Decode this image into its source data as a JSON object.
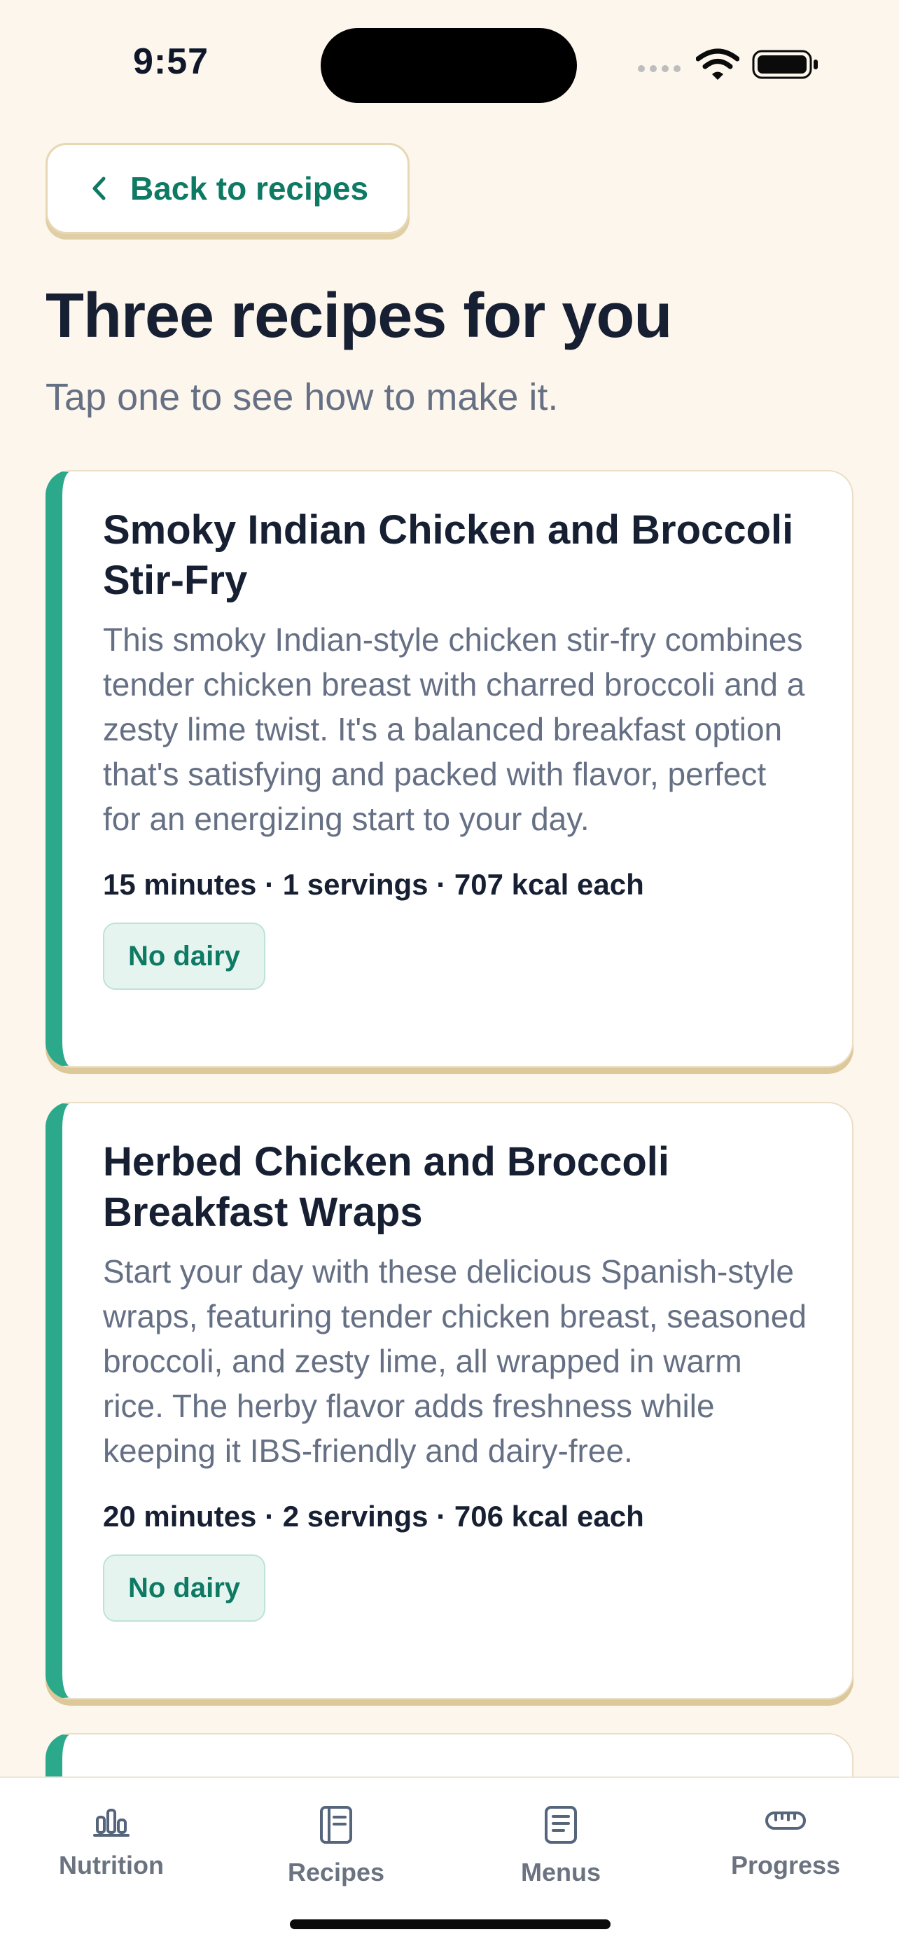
{
  "status_bar": {
    "time": "9:57"
  },
  "back_button": {
    "label": "Back to recipes",
    "icon": "chevron-left-icon"
  },
  "header": {
    "title": "Three recipes for you",
    "subtitle": "Tap one to see how to make it."
  },
  "recipes": [
    {
      "title": "Smoky Indian Chicken and Broccoli Stir-Fry",
      "description": "This smoky Indian-style chicken stir-fry combines tender chicken breast with charred broccoli and a zesty lime twist. It's a balanced breakfast option that's satisfying and packed with flavor, perfect for an energizing start to your day.",
      "meta": "15 minutes · 1 servings · 707 kcal each",
      "badge": "No dairy"
    },
    {
      "title": "Herbed Chicken and Broccoli Breakfast Wraps",
      "description": "Start your day with these delicious Spanish-style wraps, featuring tender chicken breast, seasoned broccoli, and zesty lime, all wrapped in warm rice. The herby flavor adds freshness while keeping it IBS-friendly and dairy-free.",
      "meta": "20 minutes · 2 servings · 706 kcal each",
      "badge": "No dairy"
    }
  ],
  "bottom_nav": {
    "items": [
      {
        "label": "Nutrition",
        "icon": "bar-chart-icon"
      },
      {
        "label": "Recipes",
        "icon": "recipe-book-icon"
      },
      {
        "label": "Menus",
        "icon": "menu-document-icon"
      },
      {
        "label": "Progress",
        "icon": "ruler-icon"
      }
    ]
  },
  "colors": {
    "background": "#FDF6EC",
    "accent": "#0E7A64",
    "card_stripe": "#2CA88B",
    "title_text": "#172033",
    "muted_text": "#667085"
  }
}
